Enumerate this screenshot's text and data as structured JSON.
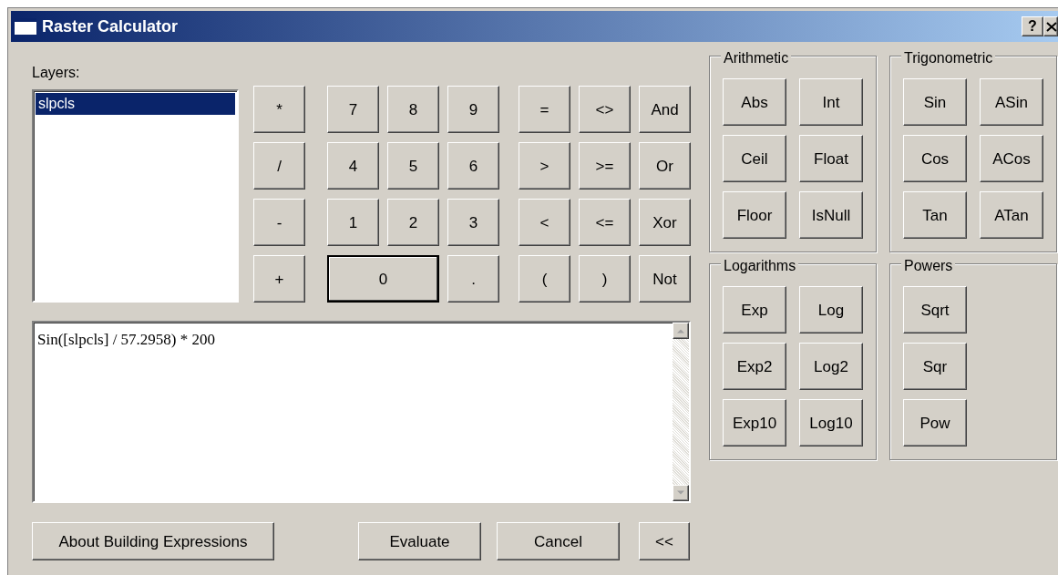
{
  "window": {
    "title": "Raster Calculator",
    "help": "?"
  },
  "layers": {
    "label": "Layers:",
    "items": [
      {
        "name": "slpcls",
        "selected": true
      }
    ]
  },
  "keypad": [
    [
      {
        "label": "*",
        "kind": "key"
      },
      {
        "label": "7",
        "kind": "key"
      },
      {
        "label": "8",
        "kind": "key"
      },
      {
        "label": "9",
        "kind": "key"
      },
      {
        "label": "=",
        "kind": "key"
      },
      {
        "label": "<>",
        "kind": "key"
      },
      {
        "label": "And",
        "kind": "key"
      }
    ],
    [
      {
        "label": "/",
        "kind": "key"
      },
      {
        "label": "4",
        "kind": "key"
      },
      {
        "label": "5",
        "kind": "key"
      },
      {
        "label": "6",
        "kind": "key"
      },
      {
        "label": ">",
        "kind": "key"
      },
      {
        "label": ">=",
        "kind": "key"
      },
      {
        "label": "Or",
        "kind": "key"
      }
    ],
    [
      {
        "label": "-",
        "kind": "key"
      },
      {
        "label": "1",
        "kind": "key"
      },
      {
        "label": "2",
        "kind": "key"
      },
      {
        "label": "3",
        "kind": "key"
      },
      {
        "label": "<",
        "kind": "key"
      },
      {
        "label": "<=",
        "kind": "key"
      },
      {
        "label": "Xor",
        "kind": "key"
      }
    ],
    [
      {
        "label": "+",
        "kind": "key"
      },
      {
        "label": "0",
        "kind": "wide"
      },
      {
        "label": ".",
        "kind": "key"
      },
      {
        "label": "(",
        "kind": "key"
      },
      {
        "label": ")",
        "kind": "key"
      },
      {
        "label": "Not",
        "kind": "key"
      }
    ]
  ],
  "expression": {
    "text": "Sin([slpcls] / 57.2958) * 200"
  },
  "function_groups": [
    {
      "title": "Arithmetic",
      "buttons": [
        "Abs",
        "Int",
        "Ceil",
        "Float",
        "Floor",
        "IsNull"
      ]
    },
    {
      "title": "Trigonometric",
      "buttons": [
        "Sin",
        "ASin",
        "Cos",
        "ACos",
        "Tan",
        "ATan"
      ]
    },
    {
      "title": "Logarithms",
      "buttons": [
        "Exp",
        "Log",
        "Exp2",
        "Log2",
        "Exp10",
        "Log10"
      ]
    },
    {
      "title": "Powers",
      "buttons": [
        "Sqrt",
        "Sqr",
        "Pow"
      ]
    }
  ],
  "footer_buttons": [
    "About Building Expressions",
    "Evaluate",
    "Cancel",
    "<<"
  ]
}
